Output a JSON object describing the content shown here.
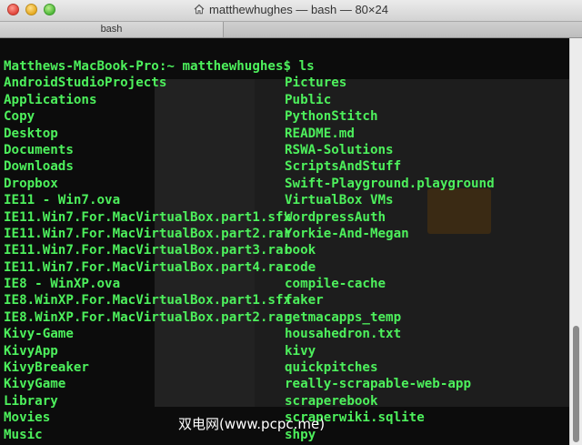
{
  "window": {
    "title": "matthewhughes — bash — 80×24",
    "title_icon": "home-icon",
    "tab_label": "bash"
  },
  "terminal": {
    "prompt": "Matthews-MacBook-Pro:~ matthewhughes$ ls",
    "text_color": "#4df05c",
    "background": "#0c0c0c",
    "column_left": [
      "AndroidStudioProjects",
      "Applications",
      "Copy",
      "Desktop",
      "Documents",
      "Downloads",
      "Dropbox",
      "IE11 - Win7.ova",
      "IE11.Win7.For.MacVirtualBox.part1.sfx",
      "IE11.Win7.For.MacVirtualBox.part2.rar",
      "IE11.Win7.For.MacVirtualBox.part3.rar",
      "IE11.Win7.For.MacVirtualBox.part4.rar",
      "IE8 - WinXP.ova",
      "IE8.WinXP.For.MacVirtualBox.part1.sfx",
      "IE8.WinXP.For.MacVirtualBox.part2.rar",
      "Kivy-Game",
      "KivyApp",
      "KivyBreaker",
      "KivyGame",
      "Library",
      "Movies",
      "Music"
    ],
    "column_right": [
      "Pictures",
      "Public",
      "PythonStitch",
      "README.md",
      "RSWA-Solutions",
      "ScriptsAndStuff",
      "Swift-Playground.playground",
      "VirtualBox VMs",
      "WordpressAuth",
      "Yorkie-And-Megan",
      "book",
      "code",
      "compile-cache",
      "faker",
      "getmacapps_temp",
      "housahedron.txt",
      "kivy",
      "quickpitches",
      "really-scrapable-web-app",
      "scraperebook",
      "scraperwiki.sqlite",
      "shpy"
    ]
  },
  "watermark": "双电网(www.pcpc.me)"
}
